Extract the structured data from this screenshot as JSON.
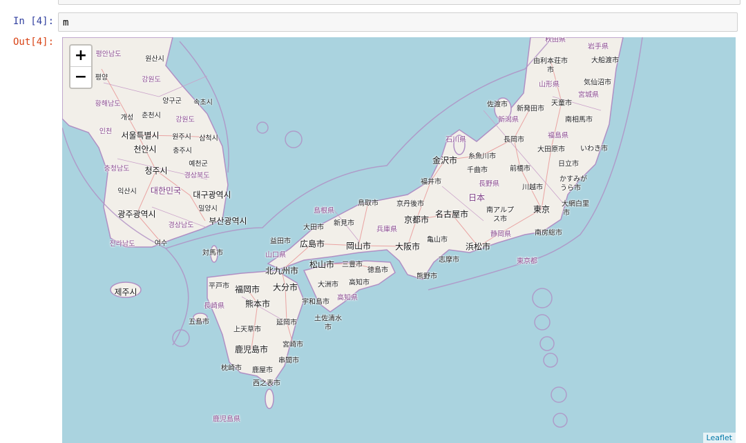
{
  "notebook": {
    "in_prompt": "In [4]:",
    "out_prompt": "Out[4]:",
    "code": "m"
  },
  "map": {
    "zoom_in": "+",
    "zoom_out": "−",
    "attribution": "Leaflet",
    "colors": {
      "sea": "#aad3df",
      "land": "#f2efe9",
      "border": "#b08fc4",
      "road": "#f0a0a0"
    },
    "labels": [
      "평안남도",
      "원산시",
      "평양",
      "강원도",
      "황해남도",
      "양구군",
      "속초시",
      "개성",
      "춘천시",
      "강원도",
      "인천",
      "서울특별시",
      "원주시",
      "삼척시",
      "천안시",
      "충주시",
      "충청남도",
      "예천군",
      "청주시",
      "경상북도",
      "익산시",
      "대한민국",
      "대구광역시",
      "광주광역시",
      "밀양시",
      "부산광역시",
      "경상남도",
      "전라남도",
      "여수",
      "제주시",
      "秋田県",
      "岩手県",
      "由利本荘市",
      "市",
      "大船渡市",
      "山形県",
      "気仙沼市",
      "宮城県",
      "佐渡市",
      "新発田市",
      "天童市",
      "新潟県",
      "南相馬市",
      "石川県",
      "長岡市",
      "福島県",
      "大田原市",
      "いわき市",
      "糸魚川市",
      "金沢市",
      "日立市",
      "千曲市",
      "前橋市",
      "かすみが",
      "うら市",
      "福井市",
      "長野県",
      "川越市",
      "日本",
      "鳥取市",
      "京丹後市",
      "島根県",
      "南アルプ",
      "ス市",
      "大網白里",
      "市",
      "東京",
      "大田市",
      "新見市",
      "兵庫県",
      "京都市",
      "名古屋市",
      "益田市",
      "広島市",
      "岡山市",
      "大阪市",
      "亀山市",
      "静岡県",
      "南房総市",
      "浜松市",
      "山口県",
      "対馬市",
      "北九州市",
      "松山市",
      "三豊市",
      "徳島市",
      "志摩市",
      "東京都",
      "熊野市",
      "平戸市",
      "福岡市",
      "大分市",
      "大洲市",
      "高知市",
      "高知県",
      "長崎県",
      "宇和島市",
      "熊本市",
      "土佐清水",
      "市",
      "五島市",
      "延岡市",
      "上天草市",
      "鹿児島市",
      "宮崎市",
      "串間市",
      "枕崎市",
      "鹿屋市",
      "西之表市",
      "鹿児島県"
    ]
  }
}
